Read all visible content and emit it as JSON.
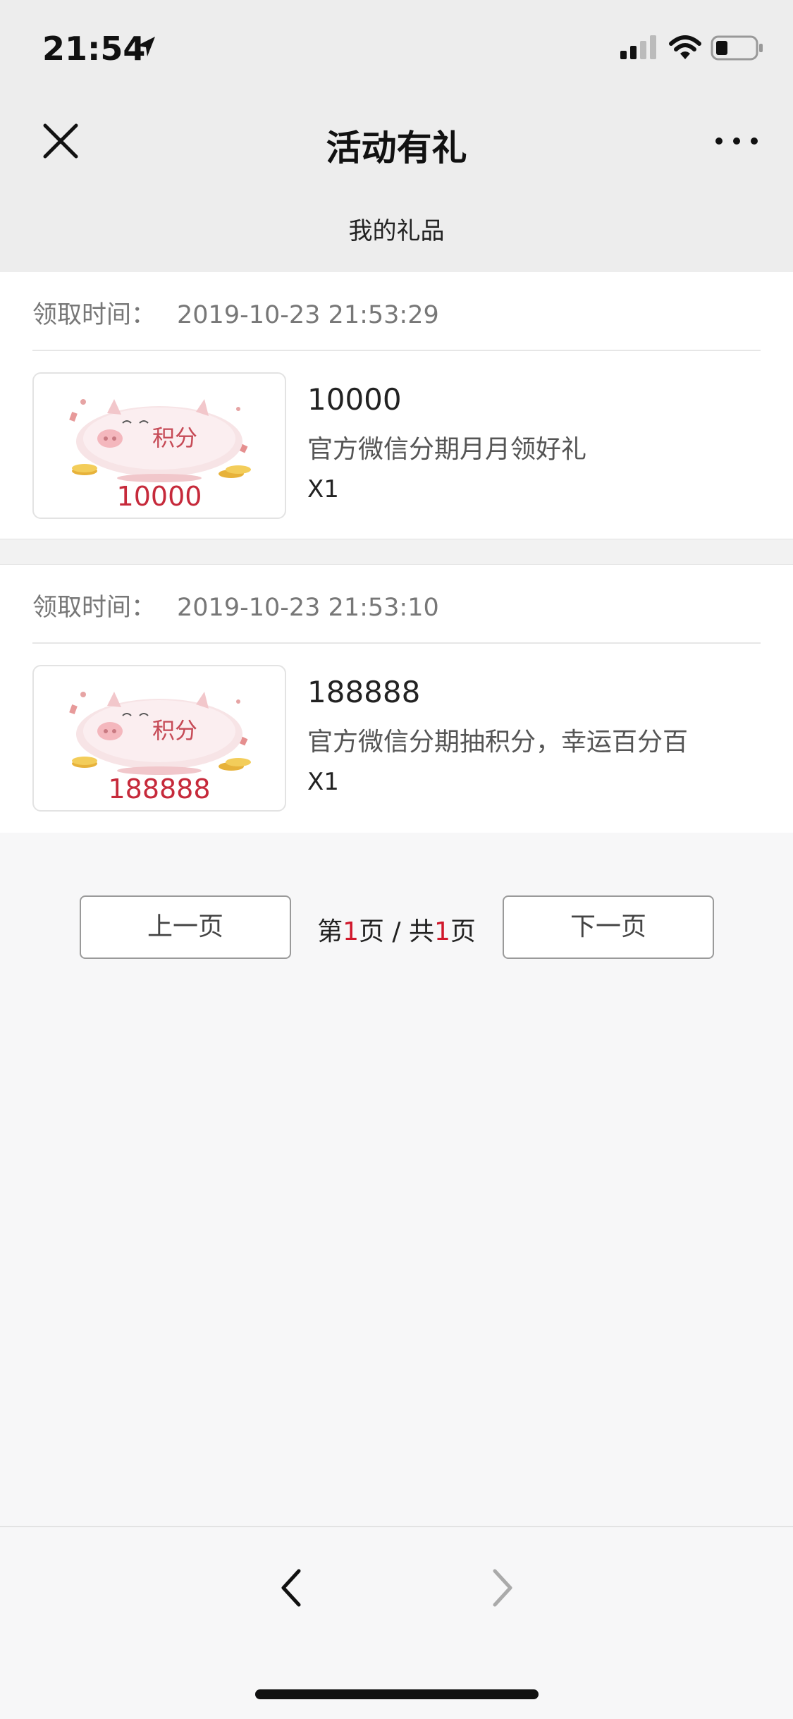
{
  "status_bar": {
    "time": "21:54"
  },
  "navbar": {
    "title": "活动有礼"
  },
  "subtitle": "我的礼品",
  "received_label": "领取时间：",
  "gifts": [
    {
      "received_time": "2019-10-23 21:53:29",
      "thumb_label": "积分",
      "thumb_amount": "10000",
      "title": "10000",
      "description": "官方微信分期月月领好礼",
      "quantity": "X1"
    },
    {
      "received_time": "2019-10-23 21:53:10",
      "thumb_label": "积分",
      "thumb_amount": "188888",
      "title": "188888",
      "description": "官方微信分期抽积分，幸运百分百",
      "quantity": "X1"
    }
  ],
  "pagination": {
    "prev_label": "上一页",
    "next_label": "下一页",
    "page_prefix": "第",
    "current_page": "1",
    "page_mid": "页 / 共",
    "total_pages": "1",
    "page_suffix": "页"
  },
  "colors": {
    "accent_red": "#c62a3b",
    "background": "#f7f7f8"
  },
  "icons": [
    "location-arrow-icon",
    "signal-icon",
    "wifi-icon",
    "battery-icon",
    "close-icon",
    "more-icon",
    "back-arrow-icon",
    "forward-arrow-icon"
  ]
}
